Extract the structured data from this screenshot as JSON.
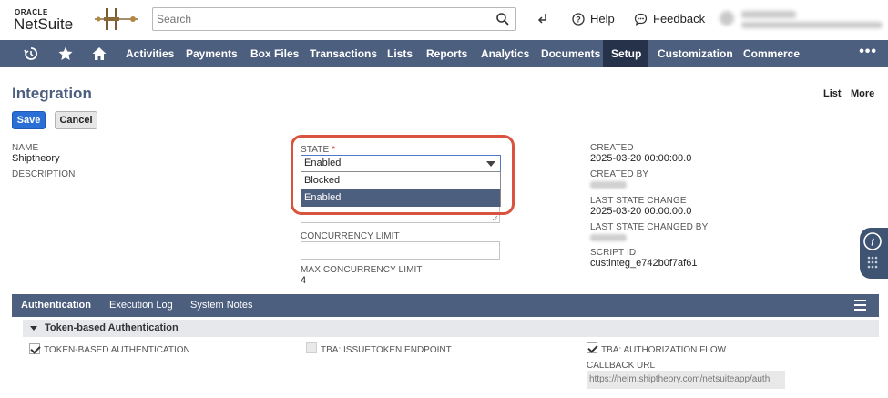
{
  "brand": {
    "oracle": "ORACLE",
    "netsuite": "NetSuite"
  },
  "search": {
    "placeholder": "Search"
  },
  "topnav": {
    "help": "Help",
    "feedback": "Feedback"
  },
  "nav": {
    "items": [
      "Activities",
      "Payments",
      "Box Files",
      "Transactions",
      "Lists",
      "Reports",
      "Analytics",
      "Documents",
      "Setup",
      "Customization",
      "Commerce"
    ],
    "active": "Setup",
    "more": "•••"
  },
  "page": {
    "title": "Integration",
    "list_link": "List",
    "more_link": "More",
    "save": "Save",
    "cancel": "Cancel"
  },
  "fields": {
    "name_label": "NAME",
    "name_value": "Shiptheory",
    "description_label": "DESCRIPTION",
    "state_label": "STATE",
    "state_required": "*",
    "state_value": "Enabled",
    "state_options": [
      "Blocked",
      "Enabled"
    ],
    "state_selected": "Enabled",
    "concurrency_label": "CONCURRENCY LIMIT",
    "max_concurrency_label": "MAX CONCURRENCY LIMIT",
    "max_concurrency_value": "4",
    "created_label": "CREATED",
    "created_value": "2025-03-20 00:00:00.0",
    "created_by_label": "CREATED BY",
    "last_state_change_label": "LAST STATE CHANGE",
    "last_state_change_value": "2025-03-20 00:00:00.0",
    "last_state_changed_by_label": "LAST STATE CHANGED BY",
    "script_id_label": "SCRIPT ID",
    "script_id_value": "custinteg_e742b0f7af61"
  },
  "subtabs": {
    "items": [
      "Authentication",
      "Execution Log",
      "System Notes"
    ],
    "active": "Authentication"
  },
  "auth": {
    "section_title": "Token-based Authentication",
    "tba_label": "TOKEN-BASED AUTHENTICATION",
    "tba_checked": true,
    "issuetoken_label": "TBA: ISSUETOKEN ENDPOINT",
    "issuetoken_checked": false,
    "authflow_label": "TBA: AUTHORIZATION FLOW",
    "authflow_checked": true,
    "callback_label": "CALLBACK URL",
    "callback_value": "https://helm.shiptheory.com/netsuiteapp/auth"
  },
  "colors": {
    "nav_bg": "#4d5f7e",
    "nav_active": "#26324a",
    "save_button": "#2a6fd6",
    "highlight_ring": "#d8543f",
    "title_color": "#4d5f7e"
  },
  "icons": {
    "search": "search-icon",
    "recent": "history-icon",
    "favorites": "star-icon",
    "home": "home-icon",
    "help": "help-circle-icon",
    "feedback": "chat-bubble-icon",
    "shortcut": "arrow-return-icon"
  }
}
